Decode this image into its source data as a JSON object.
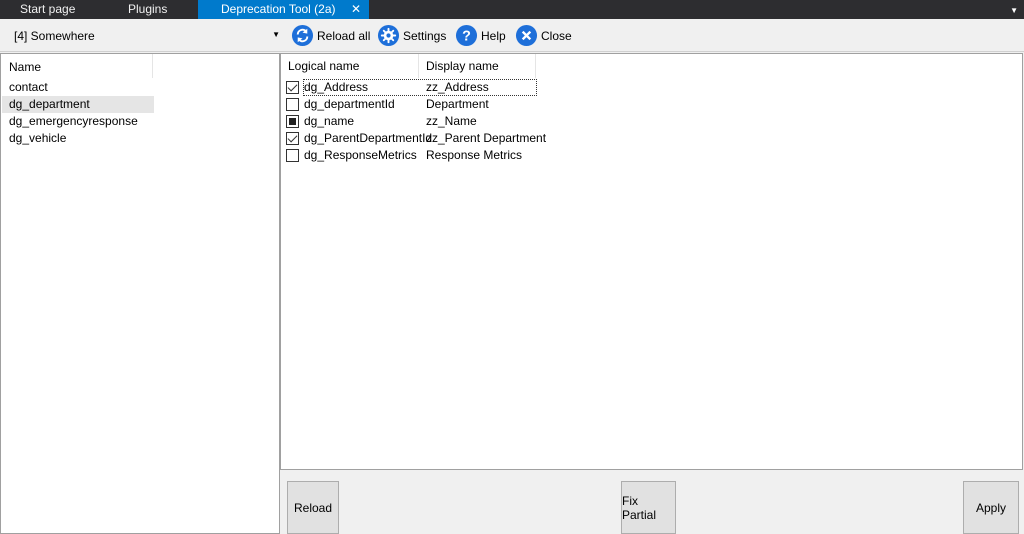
{
  "tabs": [
    {
      "label": "Start page"
    },
    {
      "label": "Plugins"
    },
    {
      "label": "Deprecation Tool (2a)",
      "close": "✕"
    }
  ],
  "tab_dropdown_icon": "chevron-down-icon",
  "toolbar": {
    "environment_value": "[4] Somewhere",
    "reload_all_label": "Reload all",
    "settings_label": "Settings",
    "help_label": "Help",
    "close_label": "Close",
    "icon_color": "#1e6fd9"
  },
  "entities": {
    "header": "Name",
    "items": [
      "contact",
      "dg_department",
      "dg_emergencyresponse",
      "dg_vehicle"
    ],
    "selected": "dg_department"
  },
  "attributes": {
    "headers": {
      "logical": "Logical name",
      "display": "Display name"
    },
    "rows": [
      {
        "logical": "dg_Address",
        "display": "zz_Address",
        "state": "checked"
      },
      {
        "logical": "dg_departmentId",
        "display": "Department",
        "state": "unchecked"
      },
      {
        "logical": "dg_name",
        "display": "zz_Name",
        "state": "indeterminate"
      },
      {
        "logical": "dg_ParentDepartmentId",
        "display": "zz_Parent Department",
        "state": "checked"
      },
      {
        "logical": "dg_ResponseMetrics",
        "display": "Response Metrics",
        "state": "unchecked"
      }
    ]
  },
  "buttons": {
    "reload": "Reload",
    "fix_partial": "Fix Partial",
    "apply": "Apply"
  }
}
